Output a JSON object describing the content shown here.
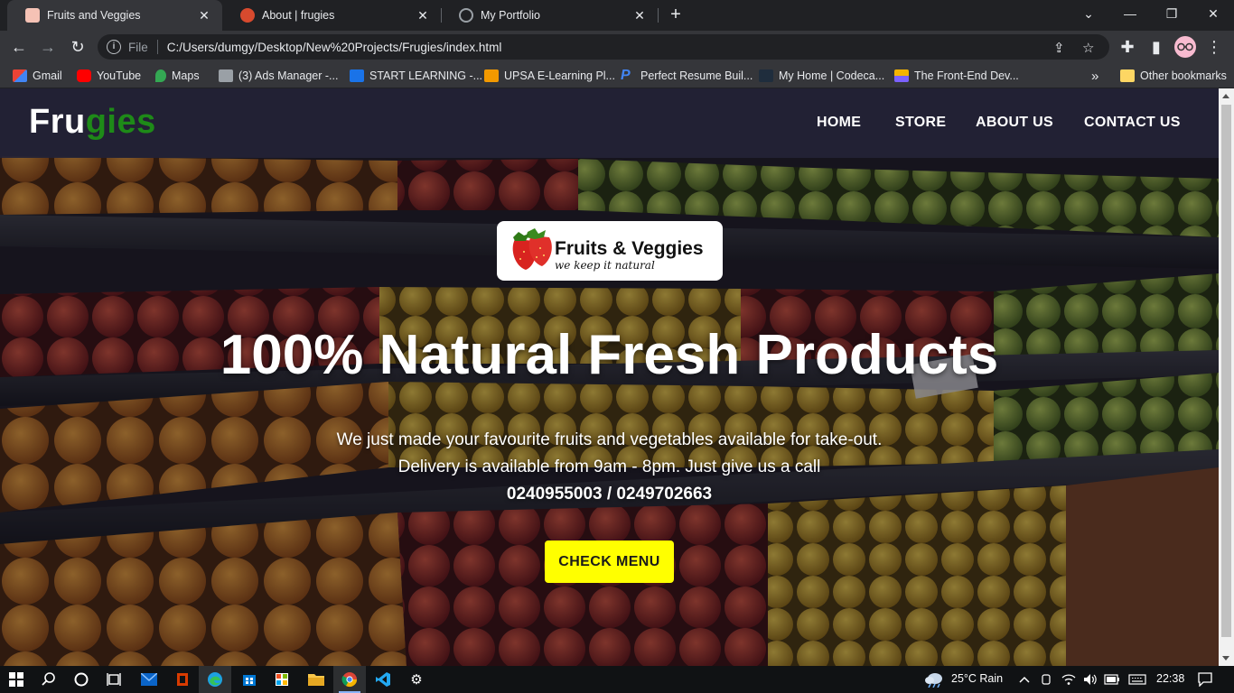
{
  "browser": {
    "tabs": [
      {
        "title": "Fruits and Veggies",
        "active": true
      },
      {
        "title": "About | frugies",
        "active": false
      },
      {
        "title": "My Portfolio",
        "active": false
      }
    ],
    "new_tab": "+",
    "window_controls": {
      "minimize": "—",
      "restore": "❐",
      "close": "✕",
      "tab_search": "⌄"
    },
    "address": {
      "scheme": "File",
      "url": "C:/Users/dumgy/Desktop/New%20Projects/Frugies/index.html"
    },
    "bookmarks": [
      {
        "label": "Gmail",
        "color": "#ea4335"
      },
      {
        "label": "YouTube",
        "color": "#ff0000"
      },
      {
        "label": "Maps",
        "color": "#34a853"
      },
      {
        "label": "(3) Ads Manager -...",
        "color": "#9aa0a6"
      },
      {
        "label": "START LEARNING -...",
        "color": "#1a73e8"
      },
      {
        "label": "UPSA E-Learning Pl...",
        "color": "#f29900"
      },
      {
        "label": "Perfect Resume Buil...",
        "color": "#4285f4"
      },
      {
        "label": "My Home | Codeca...",
        "color": "#1f2d3d"
      },
      {
        "label": "The Front-End Dev...",
        "color": "#f4b400"
      }
    ],
    "bookmarks_overflow": "»",
    "other_bookmarks": "Other bookmarks"
  },
  "site": {
    "brand_part1": "Fru",
    "brand_part2": "gies",
    "nav": [
      "HOME",
      "STORE",
      "ABOUT US",
      "CONTACT US"
    ],
    "logo_title": "Fruits & Veggies",
    "logo_tagline": "we keep it natural",
    "headline": "100% Natural Fresh Products",
    "subtext_line1": "We just made your favourite fruits and vegetables available for take-out.",
    "subtext_line2": "Delivery is available from 9am - 8pm. Just give us a call",
    "phones": "0240955003 / 0249702663",
    "cta": "CHECK MENU",
    "colors": {
      "brand_green": "#1e8a18",
      "cta_yellow": "#ffff00",
      "navbar": "#242236"
    }
  },
  "taskbar": {
    "weather": "25°C  Rain",
    "time": "22:38",
    "icons": [
      "windows-start-icon",
      "search-icon",
      "cortana-icon",
      "task-view-icon",
      "mail-icon",
      "office-icon",
      "edge-icon",
      "store-icon",
      "excel-icon",
      "file-explorer-icon",
      "chrome-icon",
      "vscode-icon",
      "settings-icon"
    ]
  }
}
